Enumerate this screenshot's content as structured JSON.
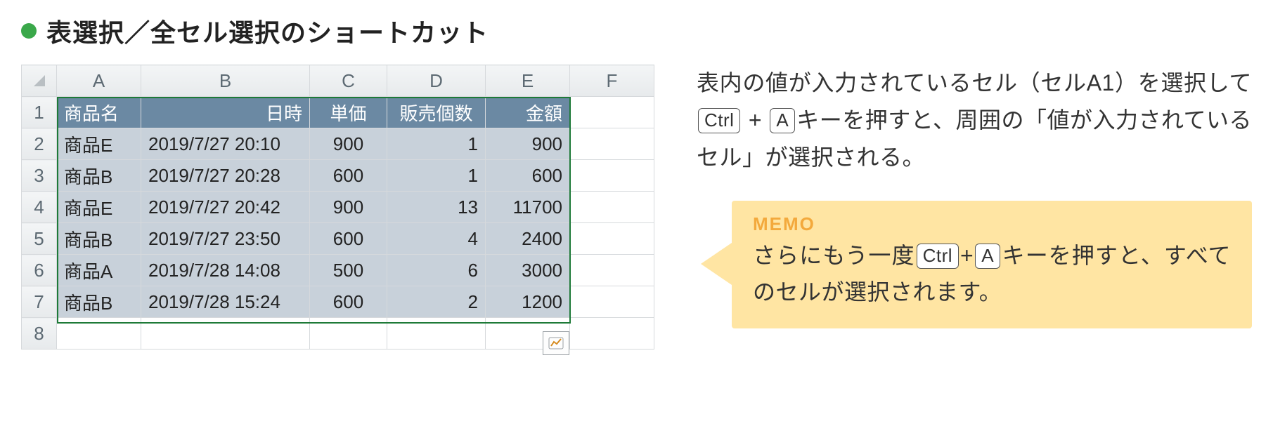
{
  "heading": "表選択／全セル選択のショートカット",
  "sheet": {
    "cols": [
      "A",
      "B",
      "C",
      "D",
      "E",
      "F"
    ],
    "rows": [
      "1",
      "2",
      "3",
      "4",
      "5",
      "6",
      "7",
      "8"
    ],
    "header": {
      "a": "商品名",
      "b": "日時",
      "c": "単価",
      "d": "販売個数",
      "e": "金額"
    },
    "data": [
      {
        "a": "商品E",
        "b": "2019/7/27 20:10",
        "c": "900",
        "d": "1",
        "e": "900"
      },
      {
        "a": "商品B",
        "b": "2019/7/27 20:28",
        "c": "600",
        "d": "1",
        "e": "600"
      },
      {
        "a": "商品E",
        "b": "2019/7/27 20:42",
        "c": "900",
        "d": "13",
        "e": "11700"
      },
      {
        "a": "商品B",
        "b": "2019/7/27 23:50",
        "c": "600",
        "d": "4",
        "e": "2400"
      },
      {
        "a": "商品A",
        "b": "2019/7/28 14:08",
        "c": "500",
        "d": "6",
        "e": "3000"
      },
      {
        "a": "商品B",
        "b": "2019/7/28 15:24",
        "c": "600",
        "d": "2",
        "e": "1200"
      }
    ]
  },
  "para": {
    "t1": "表内の値が入力されているセル（セルA1）を選択して",
    "k1": "Ctrl",
    "plus": " + ",
    "k2": "A",
    "t2": "キーを押すと、周囲の「値が入力されているセル」が選択される。"
  },
  "memo": {
    "title": "MEMO",
    "t1": "さらにもう一度",
    "k1": "Ctrl",
    "plus": "+",
    "k2": "A",
    "t2": "キーを押すと、すべてのセルが選択されます。"
  }
}
